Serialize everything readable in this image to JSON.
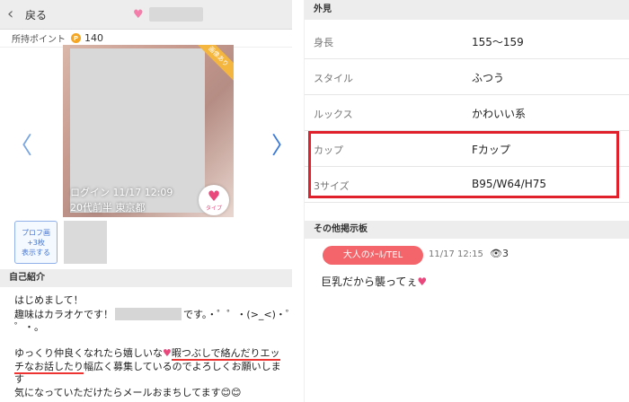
{
  "header": {
    "back_label": "戻る",
    "pin_icon": "location-pin-icon"
  },
  "points": {
    "label": "所持ポイント",
    "coin_symbol": "P",
    "value": "140"
  },
  "photo": {
    "ribbon": "画像あり",
    "login": "ログイン 11/17 12:09",
    "profile": "20代前半 東京都",
    "like_label": "タイプ"
  },
  "profile_button": {
    "line1": "プロフ画",
    "line2": "+3枚",
    "line3": "表示する"
  },
  "intro": {
    "title": "自己紹介",
    "line1": "はじめまして！",
    "line2_a": "趣味はカラオケです！",
    "line2_b": "です。・゜゜・(>_<)・゜",
    "line3": "゜・。",
    "line5_a": "ゆっくり仲良くなれたら嬉しいな",
    "line5_b": "暇つぶしで絡んだり",
    "line5_c": "エッ",
    "line6_a": "チなお話したり",
    "line6_b": "幅広く募集しているのでよろしくお願いしま",
    "line6_c": "す",
    "line7": "気になっていただけたらメールおまちしてます😊😊"
  },
  "appearance": {
    "title": "外見",
    "rows": [
      {
        "label": "身長",
        "value": "155～159"
      },
      {
        "label": "スタイル",
        "value": "ふつう"
      },
      {
        "label": "ルックス",
        "value": "かわいい系"
      },
      {
        "label": "カップ",
        "value": "Fカップ"
      },
      {
        "label": "3サイズ",
        "value": "B95/W64/H75"
      }
    ]
  },
  "board": {
    "title": "その他掲示板",
    "category": "大人のﾒｰﾙ/TEL",
    "time": "11/17 12:15",
    "views": "3",
    "post": "巨乳だから襲ってぇ"
  },
  "colors": {
    "accent_red": "#e0202a",
    "pill": "#f3656a",
    "heart": "#e9487d",
    "arrow": "#3b79d6"
  }
}
